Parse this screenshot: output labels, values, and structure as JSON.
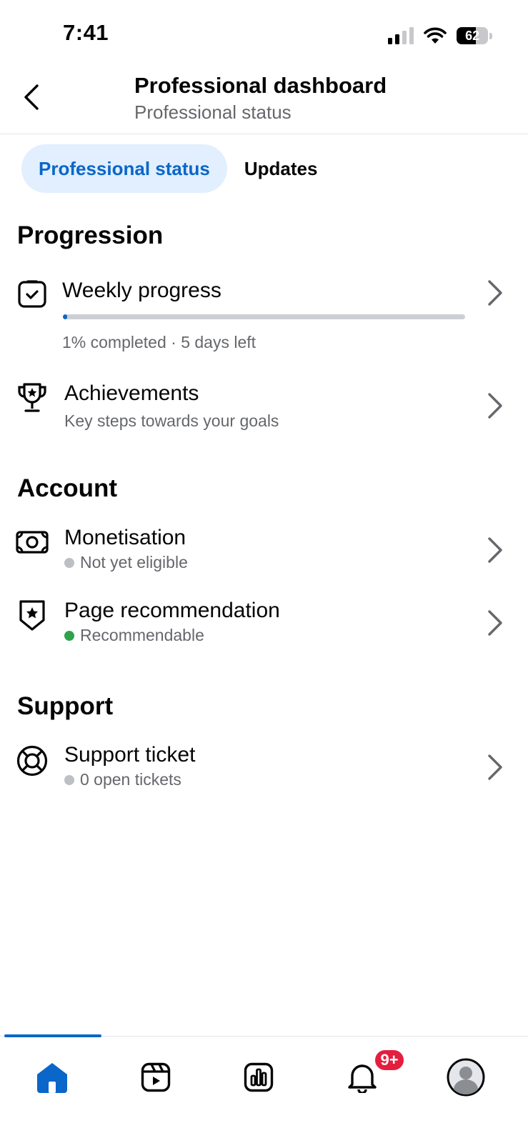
{
  "status_bar": {
    "time": "7:41",
    "battery_level": "62",
    "battery_fraction": 0.62,
    "icons": [
      "cellular-signal-icon",
      "wifi-icon",
      "battery-icon"
    ]
  },
  "header": {
    "title": "Professional dashboard",
    "subtitle": "Professional status",
    "back_icon": "back-chevron-icon"
  },
  "tabs": [
    {
      "label": "Professional status",
      "active": true
    },
    {
      "label": "Updates",
      "active": false
    }
  ],
  "progression": {
    "title": "Progression",
    "weekly": {
      "icon": "checklist-icon",
      "label": "Weekly progress",
      "progress_percent": 1,
      "status": "1% completed · 5 days left"
    },
    "achievements": {
      "icon": "trophy-icon",
      "label": "Achievements",
      "subtitle": "Key steps towards your goals"
    }
  },
  "account": {
    "title": "Account",
    "monetisation": {
      "icon": "money-icon",
      "label": "Monetisation",
      "status": "Not yet eligible",
      "status_color": "#bcc0c4"
    },
    "page_recommendation": {
      "icon": "shield-star-icon",
      "label": "Page recommendation",
      "status": "Recommendable",
      "status_color": "#31a24c"
    }
  },
  "support": {
    "title": "Support",
    "ticket": {
      "icon": "lifebuoy-icon",
      "label": "Support ticket",
      "status": "0 open tickets",
      "status_color": "#bcc0c4"
    }
  },
  "bottom_nav": {
    "items": [
      "home-icon",
      "reels-icon",
      "insights-icon",
      "notifications-icon",
      "profile-icon"
    ],
    "active": "home-icon",
    "notification_badge": "9+"
  },
  "colors": {
    "accent": "#0a66c9",
    "active_tab_bg": "#e1effe",
    "badge": "#e41e3f",
    "secondary_text": "#65676b"
  }
}
